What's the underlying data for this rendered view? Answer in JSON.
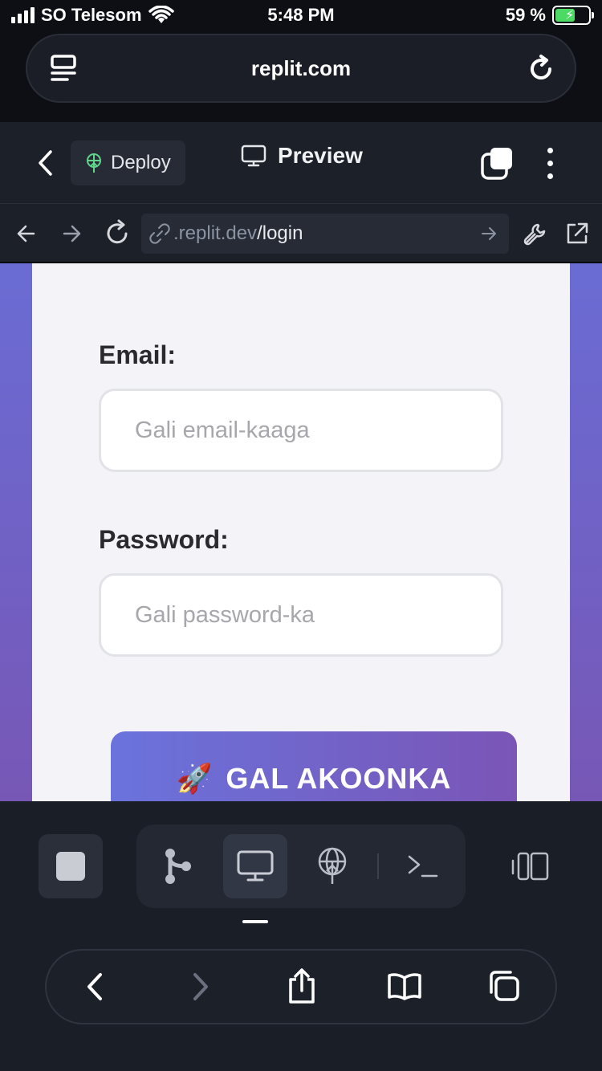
{
  "status_bar": {
    "carrier": "SO Telesom",
    "time": "5:48 PM",
    "battery_percent": "59 %",
    "battery_level": 0.59
  },
  "browser": {
    "domain": "replit.com",
    "reader_icon": "reader-mode-icon",
    "reload_icon": "reload-icon"
  },
  "replit_header": {
    "deploy_label": "Deploy",
    "preview_label": "Preview"
  },
  "webview": {
    "url_prefix": ".replit.dev",
    "url_path": "/login"
  },
  "login_form": {
    "email_label": "Email:",
    "email_placeholder": "Gali email-kaaga",
    "password_label": "Password:",
    "password_placeholder": "Gali password-ka",
    "submit_emoji": "🚀",
    "submit_label": "GAL AKOONKA"
  },
  "colors": {
    "background_gradient_start": "#6a6cd4",
    "background_gradient_end": "#7757b6",
    "deploy_icon": "#5fd68b",
    "card": "#f4f4f8"
  },
  "toolbar_icons": [
    "stop-icon",
    "git-branch-icon",
    "preview-monitor-icon",
    "deploy-globe-icon",
    "terminal-icon",
    "panel-toggle-icon"
  ],
  "safari_bottom_icons": [
    "back-icon",
    "forward-icon",
    "share-icon",
    "bookmarks-icon",
    "tabs-icon"
  ]
}
